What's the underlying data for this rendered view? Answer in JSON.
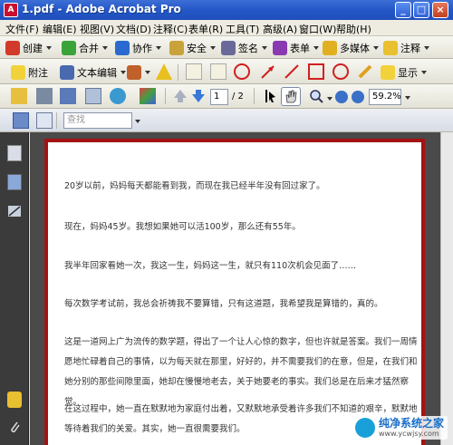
{
  "window": {
    "title": "1.pdf - Adobe Acrobat Pro",
    "app_icon_label": "A",
    "controls": [
      "_",
      "□",
      "×"
    ]
  },
  "menu": {
    "items": [
      "文件(F)",
      "编辑(E)",
      "视图(V)",
      "文档(D)",
      "注释(C)",
      "表单(R)",
      "工具(T)",
      "高级(A)",
      "窗口(W)",
      "帮助(H)"
    ]
  },
  "toolbar1": {
    "buttons": [
      "创建",
      "合并",
      "协作",
      "安全",
      "签名",
      "表单",
      "多媒体",
      "注释"
    ]
  },
  "toolbar2": {
    "attach": "附注",
    "text_edit": "文本编辑",
    "show": "显示"
  },
  "toolbar3": {
    "page_current": "1",
    "page_total": "/ 2",
    "zoom": "59.2%"
  },
  "toolbar4": {
    "search_placeholder": "查找"
  },
  "document": {
    "paragraphs": [
      "20岁以前，妈妈每天都能看到我，而现在我已经半年没有回过家了。",
      "现在，妈妈45岁。我想如果她可以活100岁，那么还有55年。",
      "我半年回家看她一次，我这一生，妈妈这一生，就只有110次机会见面了……",
      "每次数学考试前，我总会祈祷我不要算错，只有这道题，我希望我是算错的，真的。",
      "这是一道网上广为流传的数学题，得出了一个让人心惊的数字，但也许就是答案。我们一周情愿地忙碌着自己的事情，以为每天就在那里，好好的，并不需要我们的在意，但是，在我们和她分别的那些间隙里面，她却在慢慢地老去，关于她要老的事实。我们总是在后来才猛然察觉。",
      "在这过程中，她一直在默默地为家庭付出着，又默默地承受着许多我们不知道的艰辛，默默地等待着我们的关爱。其实，她一直很需要我们。"
    ]
  },
  "watermark": {
    "name": "纯净系统之家",
    "url": "www.ycwjsy.com"
  }
}
